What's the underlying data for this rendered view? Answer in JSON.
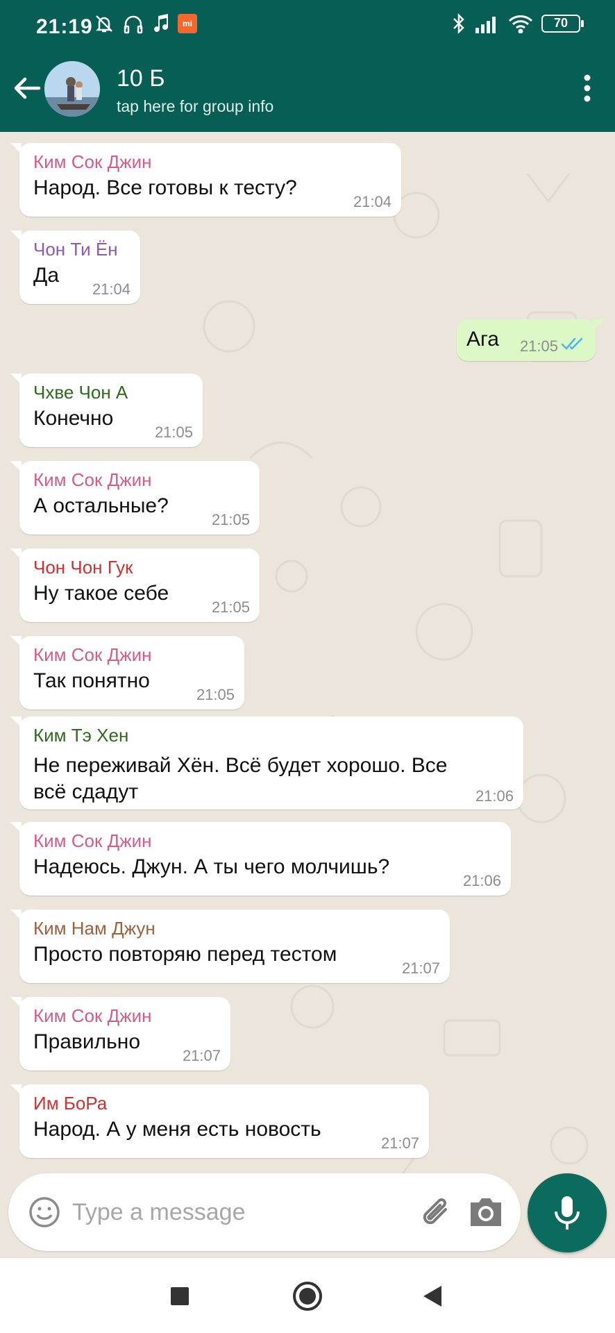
{
  "status_bar": {
    "time": "21:19",
    "battery": "70",
    "left_icons": [
      "mute-bell-icon",
      "headphones-icon",
      "music-note-icon",
      "mi-app-icon"
    ],
    "right_icons": [
      "bluetooth-icon",
      "signal-icon",
      "wifi-icon",
      "battery-icon"
    ],
    "mi_badge": "mi"
  },
  "header": {
    "title": "10 Б",
    "subtitle": "tap here for group info",
    "color": "#075e54"
  },
  "messages": [
    {
      "sender": "Ким Сок Джин",
      "sender_color": "#d85a8a",
      "text": "Народ. Все готовы к тесту?",
      "time": "21:04",
      "direction": "in"
    },
    {
      "sender": "Чон Ти Ён",
      "sender_color": "#8e5ab4",
      "text": "Да",
      "time": "21:04",
      "direction": "in"
    },
    {
      "sender": "",
      "text": "Ага",
      "time": "21:05",
      "direction": "out",
      "status": "read"
    },
    {
      "sender": "Чхве Чон А",
      "sender_color": "#2e6b1f",
      "text": "Конечно",
      "time": "21:05",
      "direction": "in"
    },
    {
      "sender": "Ким Сок Джин",
      "sender_color": "#d85a8a",
      "text": "А остальные?",
      "time": "21:05",
      "direction": "in"
    },
    {
      "sender": "Чон Чон Гук",
      "sender_color": "#d32f2f",
      "text": "Ну такое себе",
      "time": "21:05",
      "direction": "in"
    },
    {
      "sender": "Ким Сок Джин",
      "sender_color": "#d85a8a",
      "text": "Так понятно",
      "time": "21:05",
      "direction": "in"
    },
    {
      "sender": "Ким Тэ Хен",
      "sender_color": "#2e6b1f",
      "text_lines": [
        "Не переживай Хён. Всё будет хорошо. Все",
        "всё сдадут"
      ],
      "time": "21:06",
      "direction": "in"
    },
    {
      "sender": "Ким Сок Джин",
      "sender_color": "#d85a8a",
      "text": "Надеюсь. Джун. А ты чего молчишь?",
      "time": "21:06",
      "direction": "in"
    },
    {
      "sender": "Ким Нам Джун",
      "sender_color": "#a0603a",
      "text": "Просто повторяю перед тестом",
      "time": "21:07",
      "direction": "in"
    },
    {
      "sender": "Ким Сок Джин",
      "sender_color": "#d85a8a",
      "text": "Правильно",
      "time": "21:07",
      "direction": "in"
    },
    {
      "sender": "Им БоРа",
      "sender_color": "#d32f2f",
      "text": "Народ. А у меня есть новость",
      "time": "21:07",
      "direction": "in"
    }
  ],
  "composer": {
    "placeholder": "Type a message",
    "accent": "#0b6b5c"
  }
}
